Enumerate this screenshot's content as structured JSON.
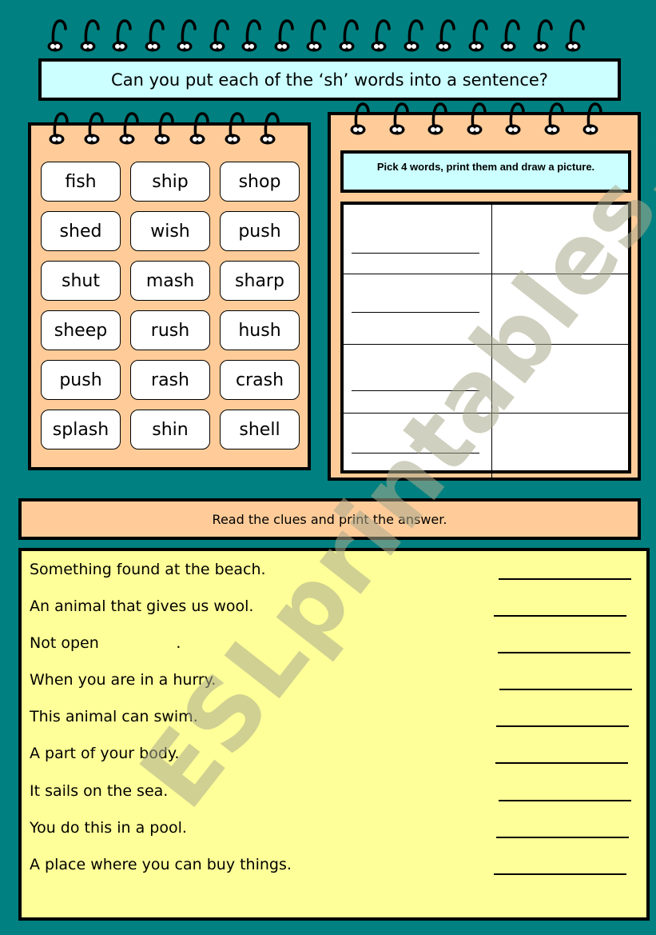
{
  "title": "Can you put each of the ‘sh’ words into a sentence?",
  "word_bank": [
    "fish",
    "ship",
    "shop",
    "shed",
    "wish",
    "push",
    "shut",
    "mash",
    "sharp",
    "sheep",
    "rush",
    "hush",
    "push",
    "rash",
    "crash",
    "splash",
    "shin",
    "shell"
  ],
  "picture_task": {
    "instruction": "Pick 4 words, print them and draw a picture.",
    "rows": 4
  },
  "clues_header": "Read the clues and print the answer.",
  "clues": [
    "Something found at the beach.",
    "An animal that gives us wool.",
    "Not open                .",
    "When you are in a hurry.",
    "This animal can swim.",
    "A part of your body.",
    "It sails on the sea.",
    "You do this in a pool.",
    "A place where you can buy things."
  ],
  "watermark": "ESLprintables.com",
  "colors": {
    "background": "#008080",
    "title_fill": "#ccffff",
    "notebook_fill": "#ffcc99",
    "clues_fill": "#ffff99"
  }
}
